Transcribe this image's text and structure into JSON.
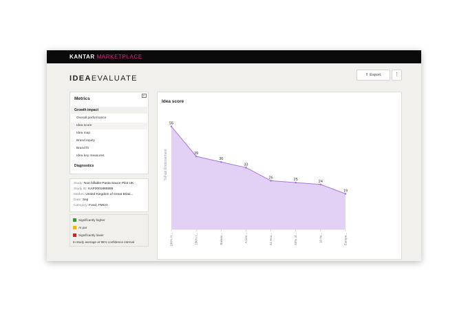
{
  "app": {
    "brand_primary": "KANTAR",
    "brand_secondary": "MARKETPLACE",
    "logo_bold": "IDEA",
    "logo_light": "EVALUATE",
    "brand_accent_color": "#e0208a"
  },
  "toolbar": {
    "export_label": "Export",
    "export_icon": "upload-icon",
    "more_icon": "more-vertical-icon",
    "more_glyph": "⋮"
  },
  "sidebar": {
    "title": "Metrics",
    "sections": [
      {
        "label": "Growth impact",
        "items": [
          {
            "label": "Overall performance"
          },
          {
            "label": "Idea score",
            "selected": true
          },
          {
            "label": "Idea map"
          },
          {
            "label": "Brand equity"
          },
          {
            "label": "Brand fit"
          },
          {
            "label": "Idea key measures"
          }
        ]
      },
      {
        "label": "Diagnostics",
        "items": []
      }
    ]
  },
  "study": {
    "rows": [
      {
        "key": "Study:",
        "value": "Non billable Pasta Sauce Pilot UK"
      },
      {
        "key": "Study ID:",
        "value": "KAP3001886989"
      },
      {
        "key": "Market:",
        "value": "United Kingdom of Great Britai..."
      },
      {
        "key": "Date:",
        "value": "Sep"
      },
      {
        "key": "Category:",
        "value": "Food, FMCG"
      }
    ]
  },
  "legend": {
    "items": [
      {
        "label": "Significantly higher",
        "color": "#2e9e2e"
      },
      {
        "label": "At par",
        "color": "#f2b705"
      },
      {
        "label": "Significantly lower",
        "color": "#d3202b"
      }
    ],
    "footnote": "to study average at 95% confidence interval"
  },
  "chart": {
    "title": "Idea score",
    "fill_color": "#e2d0f5",
    "line_color": "#a877d9"
  },
  "chart_data": {
    "type": "area",
    "title": "Idea score",
    "ylabel": "%Fast Endorsement",
    "xlabel": "",
    "categories": [
      "100% H...",
      "100% I...",
      "Balanc...",
      "A Loo...",
      "24 Hou...",
      "50% of...",
      "10 Ye...",
      "Europe..."
    ],
    "values": [
      55,
      39,
      36,
      33,
      26,
      25,
      24,
      19
    ],
    "ylim": [
      0,
      60
    ],
    "grid": false,
    "legend": "none"
  }
}
